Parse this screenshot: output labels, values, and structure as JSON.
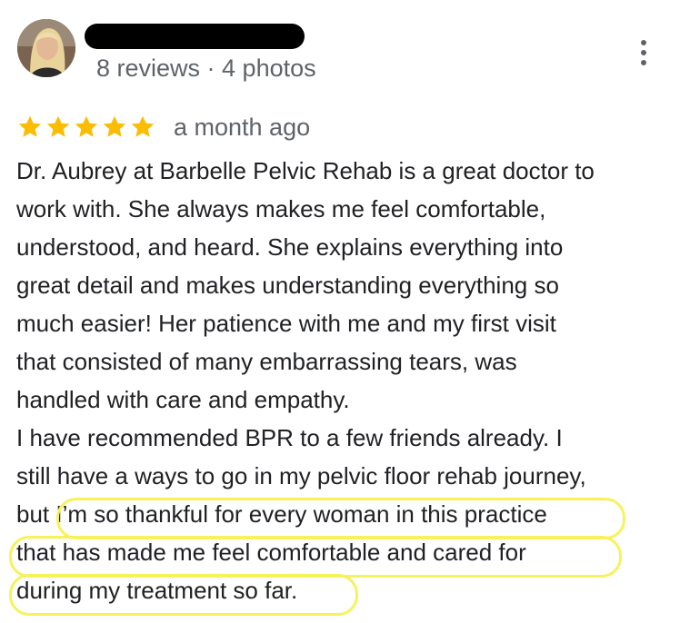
{
  "reviewer": {
    "meta": "8 reviews · 4 photos",
    "avatar_icon": "user-avatar-photo"
  },
  "menu": {
    "icon": "more-vert-icon"
  },
  "rating": {
    "stars": 5,
    "max_stars": 5,
    "star_color": "#fbbc04",
    "time_ago": "a month ago"
  },
  "review": {
    "lines": [
      "Dr. Aubrey at Barbelle Pelvic Rehab is a great doctor to",
      "work with. She always makes me feel comfortable,",
      "understood, and heard. She explains everything into",
      "great detail and makes understanding everything so",
      "much easier! Her patience with me and my first visit",
      "that consisted of many embarrassing tears, was",
      "handled with care and empathy.",
      "I have recommended BPR to a few friends already. I",
      "still have a ways to go in my pelvic floor rehab journey,",
      "but I’m so thankful for every woman in this practice",
      "that has made me feel comfortable and cared for",
      "during my treatment so far."
    ]
  },
  "highlight": {
    "color": "#f7f25a"
  }
}
